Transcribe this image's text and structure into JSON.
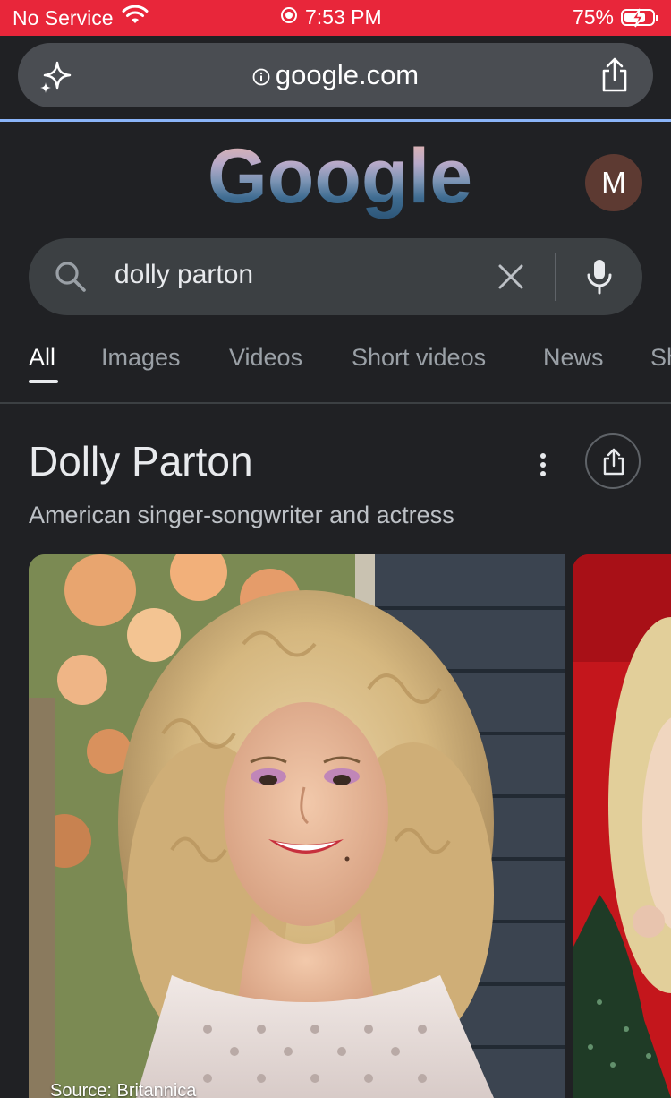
{
  "status_bar": {
    "carrier": "No Service",
    "time": "7:53 PM",
    "battery": "75%",
    "battery_level": 0.75
  },
  "browser": {
    "url": "google.com",
    "accent_color": "#8ab4f8"
  },
  "google": {
    "logo_text": "Google",
    "avatar_letter": "M"
  },
  "search": {
    "query": "dolly parton"
  },
  "tabs": [
    {
      "label": "All",
      "active": true
    },
    {
      "label": "Images"
    },
    {
      "label": "Videos"
    },
    {
      "label": "Short videos"
    },
    {
      "label": "News"
    },
    {
      "label": "Sh"
    }
  ],
  "knowledge_panel": {
    "title": "Dolly Parton",
    "subtitle": "American singer-songwriter and actress",
    "image_source": "Source: Britannica"
  },
  "colors": {
    "status_bar": "#e8263a",
    "background": "#202124",
    "search_box": "#3c4043",
    "avatar": "#5d3a32"
  }
}
